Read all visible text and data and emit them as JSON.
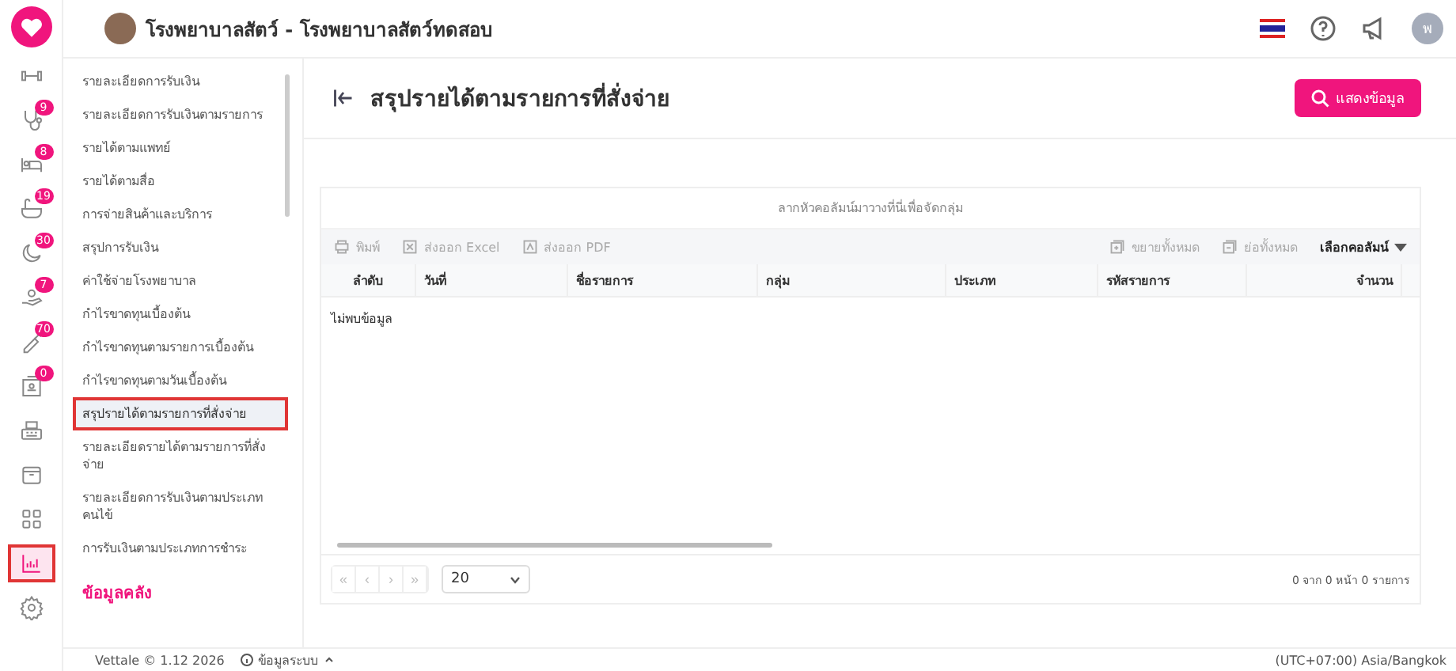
{
  "header": {
    "title": "โรงพยาบาลสัตว์ - โรงพยาบาลสัตว์ทดสอบ",
    "user_initial": "พ"
  },
  "rail": [
    {
      "selected": false
    },
    {
      "badge": "9",
      "selected": false
    },
    {
      "badge": "8",
      "selected": false
    },
    {
      "badge": "19",
      "selected": false
    },
    {
      "badge": "30",
      "selected": false
    },
    {
      "badge": "7",
      "selected": false
    },
    {
      "badge": "70",
      "selected": false
    },
    {
      "badge": "0",
      "selected": false
    },
    {
      "selected": false
    },
    {
      "selected": false
    },
    {
      "selected": false
    },
    {
      "selected": true
    },
    {
      "selected": false
    }
  ],
  "sidebar": {
    "items": [
      {
        "label": "รายละเอียดการรับเงิน",
        "selected": false
      },
      {
        "label": "รายละเอียดการรับเงินตามรายการ",
        "selected": false
      },
      {
        "label": "รายได้ตามแพทย์",
        "selected": false
      },
      {
        "label": "รายได้ตามสื่อ",
        "selected": false
      },
      {
        "label": "การจ่ายสินค้าและบริการ",
        "selected": false
      },
      {
        "label": "สรุปการรับเงิน",
        "selected": false
      },
      {
        "label": "ค่าใช้จ่ายโรงพยาบาล",
        "selected": false
      },
      {
        "label": "กำไรขาดทุนเบื้องต้น",
        "selected": false
      },
      {
        "label": "กำไรขาดทุนตามรายการเบื้องต้น",
        "selected": false
      },
      {
        "label": "กำไรขาดทุนตามวันเบื้องต้น",
        "selected": false
      },
      {
        "label": "สรุปรายได้ตามรายการที่สั่งจ่าย",
        "selected": true
      },
      {
        "label": "รายละเอียดรายได้ตามรายการที่สั่งจ่าย",
        "selected": false
      },
      {
        "label": "รายละเอียดการรับเงินตามประเภทคนไข้",
        "selected": false
      },
      {
        "label": "การรับเงินตามประเภทการชำระ",
        "selected": false
      }
    ],
    "section": "ข้อมูลคลัง"
  },
  "page": {
    "title": "สรุปรายได้ตามรายการที่สั่งจ่าย",
    "show_button": "แสดงข้อมูล"
  },
  "grid": {
    "group_hint": "ลากหัวคอลัมน์มาวางที่นี่เพื่อจัดกลุ่ม",
    "toolbar_left": [
      "พิมพ์",
      "ส่งออก Excel",
      "ส่งออก PDF"
    ],
    "toolbar_right": [
      "ขยายทั้งหมด",
      "ย่อทั้งหมด"
    ],
    "column_chooser": "เลือกคอลัมน์",
    "columns": [
      "ลำดับ",
      "วันที่",
      "ชื่อรายการ",
      "กลุ่ม",
      "ประเภท",
      "รหัสรายการ",
      "จำนวน"
    ],
    "empty": "ไม่พบข้อมูล",
    "pager": {
      "buttons": [
        "«",
        "‹",
        "›",
        "»"
      ],
      "page_size": "20",
      "summary": "0 จาก 0 หน้า 0 รายการ"
    }
  },
  "footer": {
    "version": "Vettale © 1.12 2026",
    "system_info": "ข้อมูลระบบ",
    "timezone": "(UTC+07:00) Asia/Bangkok"
  }
}
